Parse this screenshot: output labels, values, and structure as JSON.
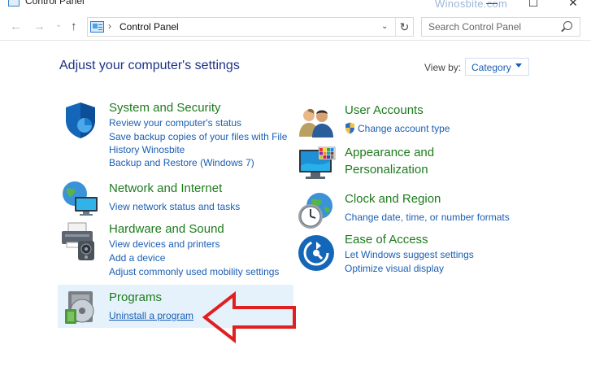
{
  "window": {
    "title": "Control Panel",
    "watermark": "Winosbite.com",
    "controls": {
      "minimize": "—",
      "maximize": "☐",
      "close": "✕"
    }
  },
  "nav": {
    "back": "←",
    "forward": "→",
    "recent": "⌄",
    "up": "↑",
    "breadcrumb_sep": "›",
    "breadcrumb": "Control Panel",
    "dropdown": "⌄",
    "refresh": "↻",
    "search_placeholder": "Search Control Panel"
  },
  "main": {
    "heading": "Adjust your computer's settings",
    "view_by_label": "View by:",
    "view_by_value": "Category"
  },
  "left_categories": [
    {
      "title": "System and Security",
      "icon": "shield-icon",
      "links": [
        "Review your computer's status",
        "Save backup copies of your files with File",
        "History Winosbite",
        "Backup and Restore (Windows 7)"
      ]
    },
    {
      "title": "Network and Internet",
      "icon": "network-icon",
      "links": [
        "View network status and tasks"
      ]
    },
    {
      "title": "Hardware and Sound",
      "icon": "printer-icon",
      "links": [
        "View devices and printers",
        "Add a device",
        "Adjust commonly used mobility settings"
      ]
    },
    {
      "title": "Programs",
      "icon": "programs-icon",
      "links": [
        "Uninstall a program"
      ]
    }
  ],
  "right_categories": [
    {
      "title": "User Accounts",
      "icon": "users-icon",
      "links": [
        "Change account type"
      ]
    },
    {
      "title_line1": "Appearance and",
      "title_line2": "Personalization",
      "icon": "monitor-icon",
      "links": []
    },
    {
      "title": "Clock and Region",
      "icon": "clock-icon",
      "links": [
        "Change date, time, or number formats"
      ]
    },
    {
      "title": "Ease of Access",
      "icon": "access-icon",
      "links": [
        "Let Windows suggest settings",
        "Optimize visual display"
      ]
    }
  ],
  "colors": {
    "heading": "#1e3287",
    "category_title": "#1d7b1d",
    "link": "#1b5fb4",
    "highlight": "#e6f2fb",
    "arrow": "#e02020"
  }
}
